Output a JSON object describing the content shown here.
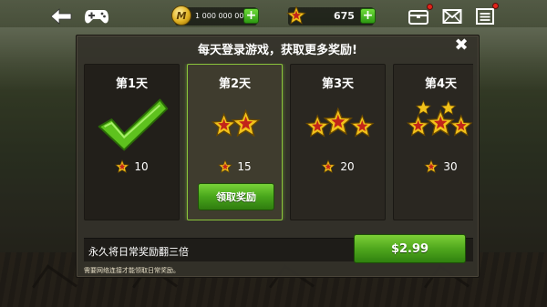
{
  "resources": {
    "money_icon_letter": "M",
    "money_value": "1 000 000 000",
    "stars_value": "675",
    "plus_label": "+"
  },
  "icons": {
    "back": "back-arrow-icon",
    "gamepad": "gamepad-icon",
    "chest": "chest-icon",
    "mail": "mail-icon",
    "menu": "menu-icon",
    "star": "star-icon",
    "checkmark": "checkmark-icon"
  },
  "dialog": {
    "title": "每天登录游戏，获取更多奖励!",
    "close_label": "✖",
    "days": [
      {
        "label": "第1天",
        "reward": "10",
        "stars": 0,
        "state": "claimed"
      },
      {
        "label": "第2天",
        "reward": "15",
        "stars": 2,
        "state": "active",
        "button": "领取奖励"
      },
      {
        "label": "第3天",
        "reward": "20",
        "stars": 3,
        "state": "locked"
      },
      {
        "label": "第4天",
        "reward": "30",
        "stars": 5,
        "state": "locked"
      }
    ],
    "offer_text": "永久将日常奖励翻三倍",
    "price": "$2.99",
    "note": "需要网络连接才能领取日常奖励。"
  },
  "colors": {
    "accent_green": "#4fa71d",
    "star_gold": "#f2c21a",
    "star_red": "#c2241a",
    "notification_red": "#e3241b"
  }
}
